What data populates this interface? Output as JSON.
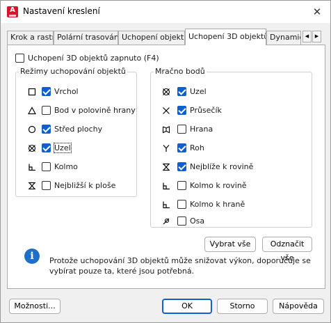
{
  "window": {
    "title": "Nastavení kreslení",
    "close_symbol": "✕"
  },
  "tabs": [
    {
      "label": "Krok a rastr"
    },
    {
      "label": "Polární trasování"
    },
    {
      "label": "Uchopení objektu"
    },
    {
      "label": "Uchopení 3D objektů",
      "active": true
    },
    {
      "label": "Dynamick"
    }
  ],
  "tab_scroll": {
    "left": "◀",
    "right": "▶"
  },
  "main": {
    "enable_label": "Uchopení 3D objektů zapnuto (F4)",
    "enable_checked": false,
    "object_group_title": "Režimy uchopování objektů",
    "object_modes": [
      {
        "label": "Vrchol",
        "checked": true,
        "icon": "square-icon"
      },
      {
        "label": "Bod v polovině hrany",
        "checked": false,
        "icon": "triangle-icon"
      },
      {
        "label": "Střed plochy",
        "checked": true,
        "icon": "circle-icon"
      },
      {
        "label": "Uzel",
        "checked": true,
        "icon": "node-icon"
      },
      {
        "label": "Kolmo",
        "checked": false,
        "icon": "perpendicular-icon"
      },
      {
        "label": "Nejbližší k ploše",
        "checked": false,
        "icon": "hourglass-icon"
      }
    ],
    "cloud_group_title": "Mračno bodů",
    "cloud_modes": [
      {
        "label": "Uzel",
        "checked": true,
        "icon": "node-icon"
      },
      {
        "label": "Průsečík",
        "checked": true,
        "icon": "intersection-icon"
      },
      {
        "label": "Hrana",
        "checked": false,
        "icon": "edge-icon"
      },
      {
        "label": "Roh",
        "checked": true,
        "icon": "corner-icon"
      },
      {
        "label": "Nejblíže k rovině",
        "checked": true,
        "icon": "hourglass-icon"
      },
      {
        "label": "Kolmo k rovině",
        "checked": false,
        "icon": "perpendicular-icon"
      },
      {
        "label": "Kolmo k hraně",
        "checked": false,
        "icon": "perpendicular-icon"
      },
      {
        "label": "Osa",
        "checked": false,
        "icon": "axis-icon"
      }
    ],
    "select_all_label": "Vybrat vše",
    "deselect_all_label": "Odznačit vše",
    "info_symbol": "i",
    "info_line1": "Protože uchopování 3D objektů může snižovat výkon, doporučuje se",
    "info_line2": "vybírat pouze ta, které jsou potřebná."
  },
  "footer": {
    "options_label": "Možnosti...",
    "ok_label": "OK",
    "cancel_label": "Storno",
    "help_label": "Nápověda"
  },
  "colors": {
    "accent": "#0f5fcc",
    "brand": "#d8132a",
    "info": "#1f6fc9"
  }
}
